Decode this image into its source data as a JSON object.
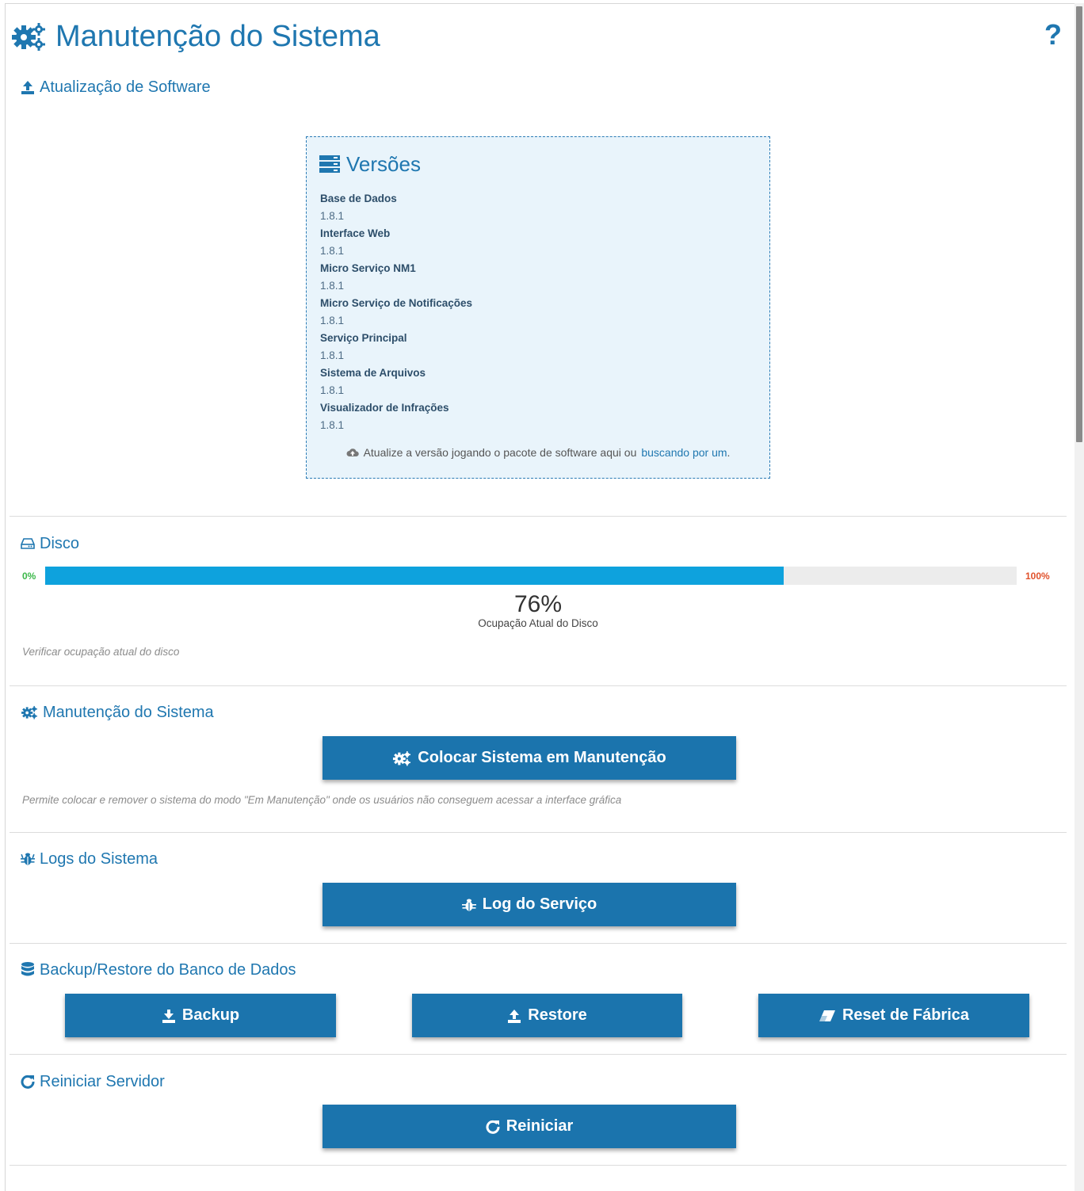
{
  "page": {
    "title": "Manutenção do Sistema",
    "help_icon": "question-icon"
  },
  "software_update": {
    "title": "Atualização de Software",
    "versions_title": "Versões",
    "items": [
      {
        "name": "Base de Dados",
        "version": "1.8.1"
      },
      {
        "name": "Interface Web",
        "version": "1.8.1"
      },
      {
        "name": "Micro Serviço NM1",
        "version": "1.8.1"
      },
      {
        "name": "Micro Serviço de Notificações",
        "version": "1.8.1"
      },
      {
        "name": "Serviço Principal",
        "version": "1.8.1"
      },
      {
        "name": "Sistema de Arquivos",
        "version": "1.8.1"
      },
      {
        "name": "Visualizador de Infrações",
        "version": "1.8.1"
      }
    ],
    "drop_hint": "Atualize a versão jogando o pacote de software aqui ou",
    "drop_link": "buscando por um",
    "drop_end": "."
  },
  "disk": {
    "title": "Disco",
    "min_label": "0%",
    "max_label": "100%",
    "usage_percent": 76,
    "usage_text": "76%",
    "caption": "Ocupação Atual do Disco",
    "hint": "Verificar ocupação atual do disco",
    "colors": {
      "fill": "#0ea2dd",
      "min": "#3cb84a",
      "max": "#e0512b"
    }
  },
  "maintenance": {
    "title": "Manutenção do Sistema",
    "button": "Colocar Sistema em Manutenção",
    "hint": "Permite colocar e remover o sistema do modo \"Em Manutenção\" onde os usuários não conseguem acessar a interface gráfica"
  },
  "logs": {
    "title": "Logs do Sistema",
    "button": "Log do Serviço"
  },
  "backup": {
    "title": "Backup/Restore do Banco de Dados",
    "backup_button": "Backup",
    "restore_button": "Restore",
    "reset_button": "Reset de Fábrica"
  },
  "restart": {
    "title": "Reiniciar Servidor",
    "button": "Reiniciar"
  },
  "theme": {
    "accent": "#1f77b0",
    "button_bg": "#1b74ad"
  }
}
